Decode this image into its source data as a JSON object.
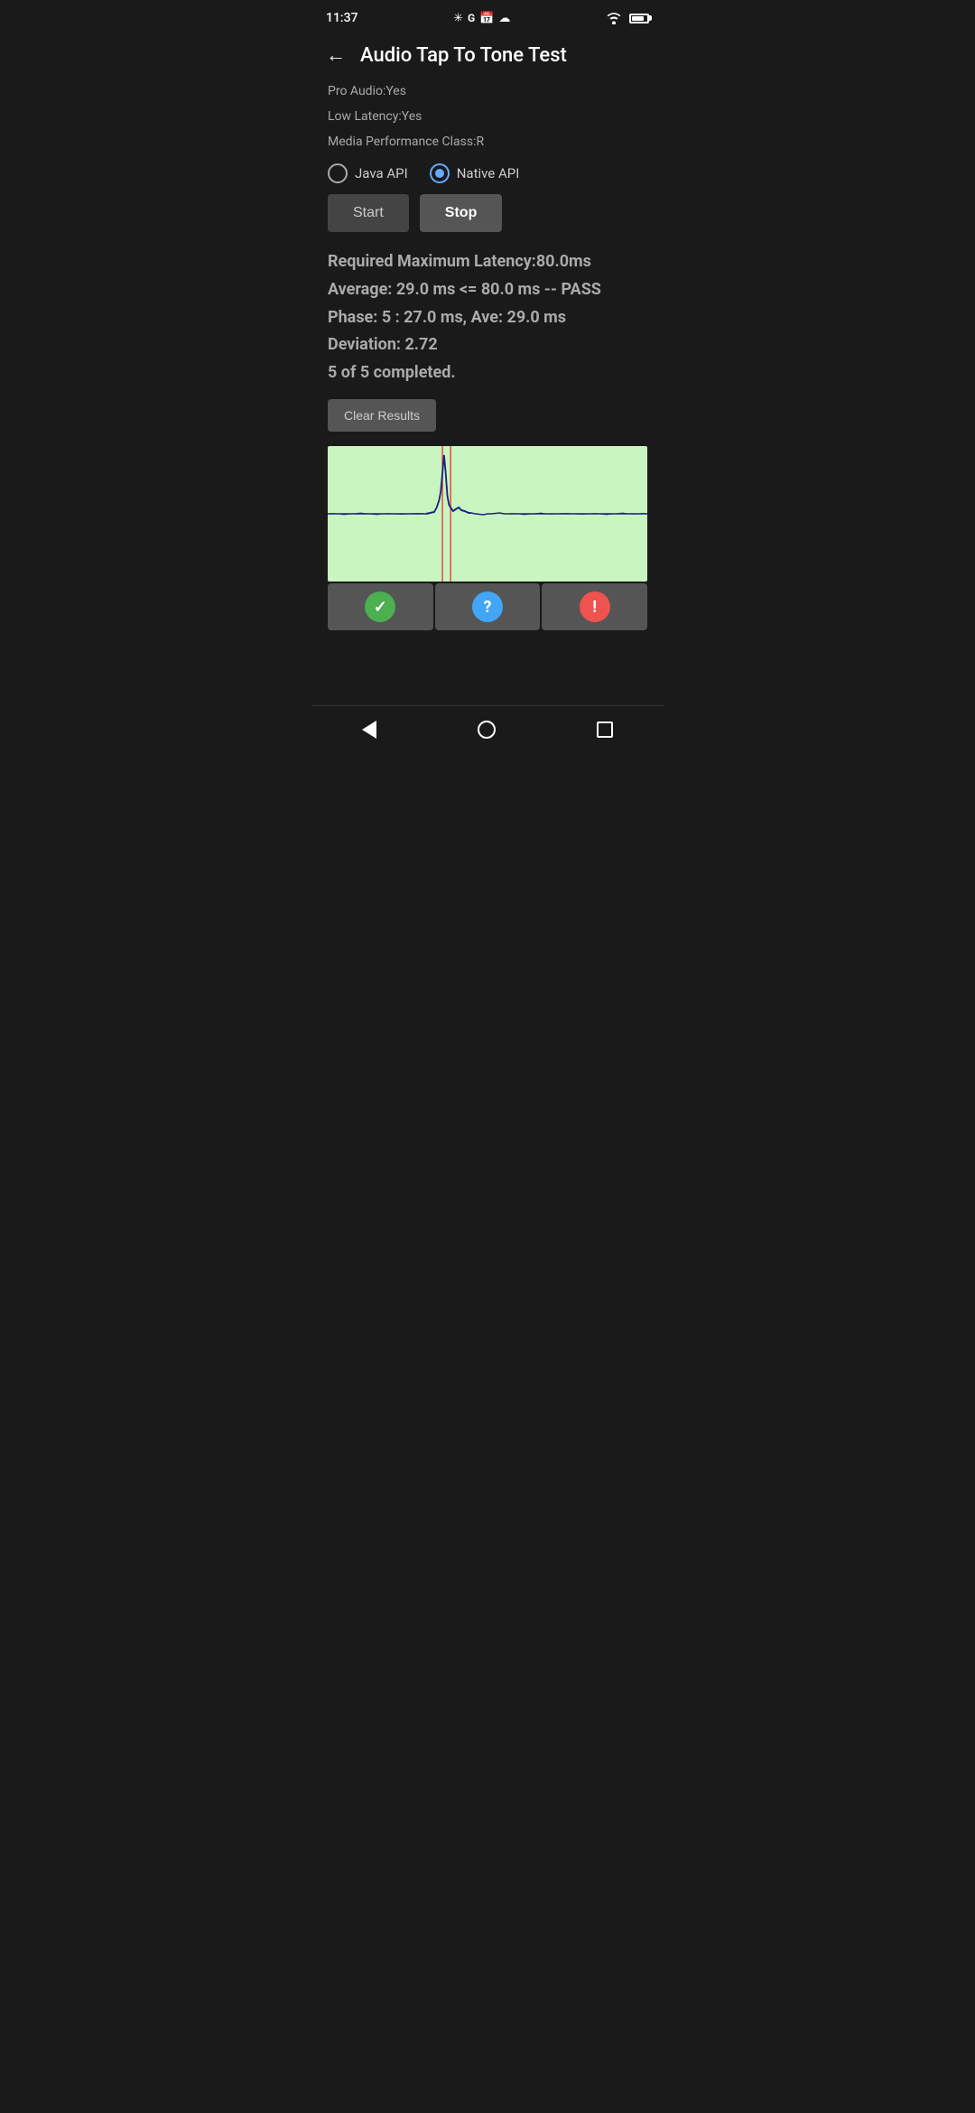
{
  "statusBar": {
    "time": "11:37",
    "leftIcons": [
      "fan",
      "google",
      "calendar",
      "cloud"
    ],
    "rightIcons": [
      "wifi",
      "battery"
    ]
  },
  "header": {
    "backLabel": "←",
    "title": "Audio Tap To Tone Test"
  },
  "deviceInfo": {
    "proAudio": "Pro Audio:Yes",
    "lowLatency": "Low Latency:Yes",
    "mediaPerformanceClass": "Media Performance Class:R"
  },
  "apiSelector": {
    "options": [
      {
        "id": "java",
        "label": "Java API",
        "selected": false
      },
      {
        "id": "native",
        "label": "Native API",
        "selected": true
      }
    ]
  },
  "controls": {
    "startLabel": "Start",
    "stopLabel": "Stop"
  },
  "results": {
    "line1": "Required Maximum Latency:80.0ms",
    "line2": "Average: 29.0 ms <= 80.0 ms -- PASS",
    "line3": "Phase: 5 : 27.0 ms, Ave: 29.0 ms",
    "line4": "Deviation: 2.72",
    "line5": "5 of 5 completed."
  },
  "clearButton": {
    "label": "Clear Results"
  },
  "statusIcons": [
    {
      "id": "pass",
      "type": "check",
      "color": "green"
    },
    {
      "id": "unknown",
      "type": "question",
      "color": "blue"
    },
    {
      "id": "fail",
      "type": "exclamation",
      "color": "red"
    }
  ],
  "navBar": {
    "back": "back",
    "home": "home",
    "recents": "recents"
  }
}
